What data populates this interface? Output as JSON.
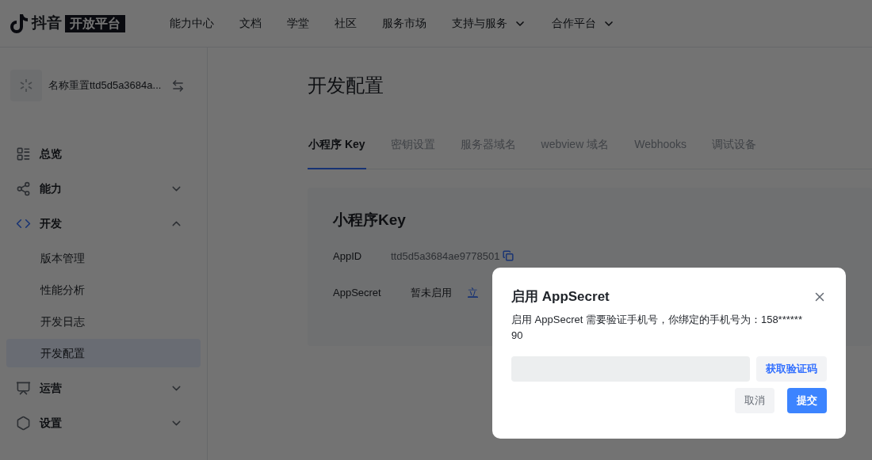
{
  "logo": {
    "brand": "抖音",
    "platform": "开放平台"
  },
  "nav": [
    {
      "label": "能力中心",
      "kind": "link"
    },
    {
      "label": "文档",
      "kind": "link"
    },
    {
      "label": "学堂",
      "kind": "link"
    },
    {
      "label": "社区",
      "kind": "link"
    },
    {
      "label": "服务市场",
      "kind": "link"
    },
    {
      "label": "支持与服务",
      "kind": "menu"
    },
    {
      "label": "合作平台",
      "kind": "menu"
    }
  ],
  "app": {
    "name": "名称重置ttd5d5a3684a..."
  },
  "sidebar": {
    "items": [
      {
        "label": "总览"
      },
      {
        "label": "能力",
        "expanded": false
      },
      {
        "label": "开发",
        "expanded": true,
        "children": [
          {
            "label": "版本管理",
            "selected": false
          },
          {
            "label": "性能分析",
            "selected": false
          },
          {
            "label": "开发日志",
            "selected": false
          },
          {
            "label": "开发配置",
            "selected": true
          }
        ]
      },
      {
        "label": "运营",
        "expanded": false
      },
      {
        "label": "设置",
        "expanded": false
      }
    ]
  },
  "page_title": "开发配置",
  "tabs": [
    {
      "label": "小程序 Key",
      "selected": true
    },
    {
      "label": "密钥设置",
      "selected": false
    },
    {
      "label": "服务器域名",
      "selected": false
    },
    {
      "label": "webview 域名",
      "selected": false
    },
    {
      "label": "Webhooks",
      "selected": false
    },
    {
      "label": "调试设备",
      "selected": false
    }
  ],
  "card": {
    "title": "小程序Key",
    "appid": {
      "label": "AppID",
      "value": "ttd5d5a3684ae9778501"
    },
    "appsecret": {
      "label": "AppSecret",
      "status": "暂未启用",
      "link": "立"
    }
  },
  "dialog": {
    "title": "启用 AppSecret",
    "message": "启用 AppSecret 需要验证手机号，你绑定的手机号为：158******90",
    "code_button": "获取验证码",
    "cancel": "取消",
    "submit": "提交"
  }
}
